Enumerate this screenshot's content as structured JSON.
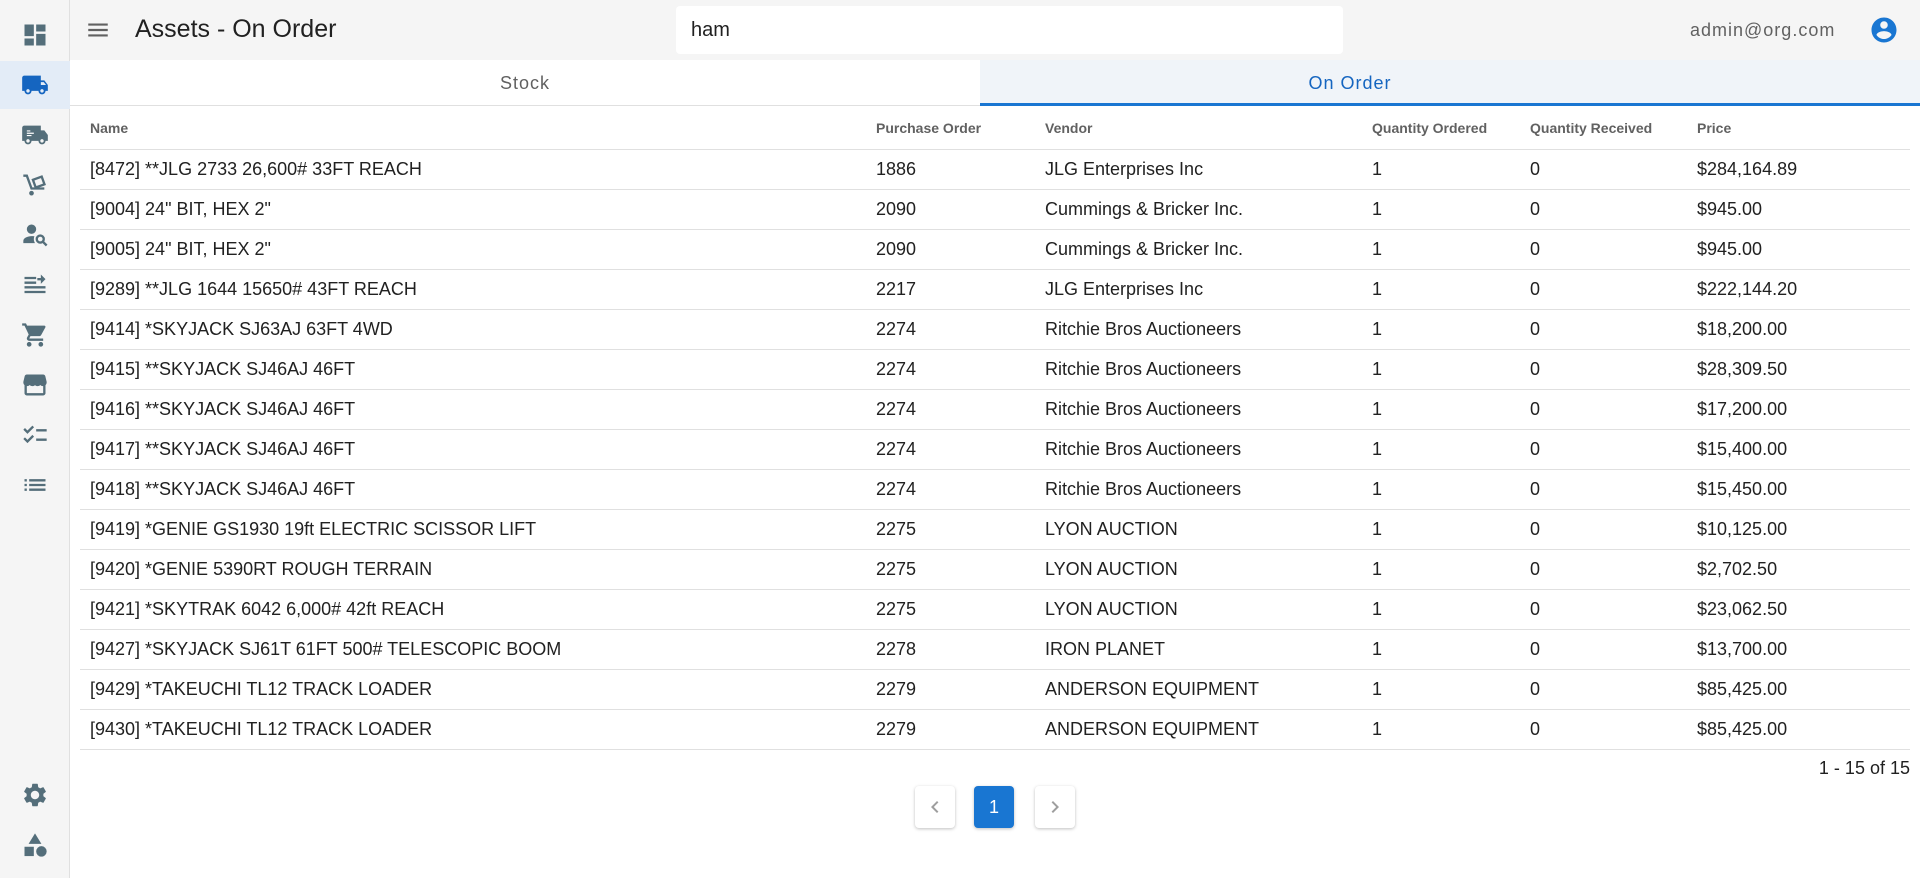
{
  "header": {
    "title": "Assets - On Order",
    "search_value": "ham",
    "user_email": "admin@org.com"
  },
  "sidebar": {
    "items": [
      {
        "icon": "dashboard-icon"
      },
      {
        "icon": "truck-icon",
        "active": true
      },
      {
        "icon": "moving-truck-icon"
      },
      {
        "icon": "hand-truck-icon"
      },
      {
        "icon": "person-search-icon"
      },
      {
        "icon": "transfer-list-icon"
      },
      {
        "icon": "cart-icon"
      },
      {
        "icon": "store-icon"
      },
      {
        "icon": "checklist-icon"
      },
      {
        "icon": "list-icon"
      }
    ],
    "bottom_items": [
      {
        "icon": "gear-icon"
      },
      {
        "icon": "shapes-icon"
      }
    ]
  },
  "tabs": [
    {
      "label": "Stock",
      "active": false
    },
    {
      "label": "On Order",
      "active": true
    }
  ],
  "table": {
    "headers": [
      "Name",
      "Purchase Order",
      "Vendor",
      "Quantity Ordered",
      "Quantity Received",
      "Price"
    ],
    "rows": [
      [
        "[8472] **JLG 2733 26,600# 33FT REACH",
        "1886",
        "JLG Enterprises Inc",
        "1",
        "0",
        "$284,164.89"
      ],
      [
        "[9004] 24\" BIT, HEX 2\"",
        "2090",
        "Cummings & Bricker Inc.",
        "1",
        "0",
        "$945.00"
      ],
      [
        "[9005] 24\" BIT, HEX 2\"",
        "2090",
        "Cummings & Bricker Inc.",
        "1",
        "0",
        "$945.00"
      ],
      [
        "[9289] **JLG 1644 15650# 43FT REACH",
        "2217",
        "JLG Enterprises Inc",
        "1",
        "0",
        "$222,144.20"
      ],
      [
        "[9414] *SKYJACK SJ63AJ 63FT 4WD",
        "2274",
        "Ritchie Bros Auctioneers",
        "1",
        "0",
        "$18,200.00"
      ],
      [
        "[9415] **SKYJACK SJ46AJ 46FT",
        "2274",
        "Ritchie Bros Auctioneers",
        "1",
        "0",
        "$28,309.50"
      ],
      [
        "[9416] **SKYJACK SJ46AJ 46FT",
        "2274",
        "Ritchie Bros Auctioneers",
        "1",
        "0",
        "$17,200.00"
      ],
      [
        "[9417] **SKYJACK SJ46AJ 46FT",
        "2274",
        "Ritchie Bros Auctioneers",
        "1",
        "0",
        "$15,400.00"
      ],
      [
        "[9418] **SKYJACK SJ46AJ 46FT",
        "2274",
        "Ritchie Bros Auctioneers",
        "1",
        "0",
        "$15,450.00"
      ],
      [
        "[9419] *GENIE GS1930 19ft ELECTRIC SCISSOR LIFT",
        "2275",
        "LYON AUCTION",
        "1",
        "0",
        "$10,125.00"
      ],
      [
        "[9420] *GENIE 5390RT ROUGH TERRAIN",
        "2275",
        "LYON AUCTION",
        "1",
        "0",
        "$2,702.50"
      ],
      [
        "[9421] *SKYTRAK 6042 6,000# 42ft REACH",
        "2275",
        "LYON AUCTION",
        "1",
        "0",
        "$23,062.50"
      ],
      [
        "[9427] *SKYJACK SJ61T 61FT 500# TELESCOPIC BOOM",
        "2278",
        "IRON PLANET",
        "1",
        "0",
        "$13,700.00"
      ],
      [
        "[9429] *TAKEUCHI TL12 TRACK LOADER",
        "2279",
        "ANDERSON EQUIPMENT",
        "1",
        "0",
        "$85,425.00"
      ],
      [
        "[9430] *TAKEUCHI TL12 TRACK LOADER",
        "2279",
        "ANDERSON EQUIPMENT",
        "1",
        "0",
        "$85,425.00"
      ]
    ]
  },
  "pagination": {
    "info": "1 - 15 of 15",
    "current_page": "1"
  },
  "colors": {
    "accent": "#1976d2",
    "icon": "#546e7a",
    "active_nav": "#1565c0"
  }
}
